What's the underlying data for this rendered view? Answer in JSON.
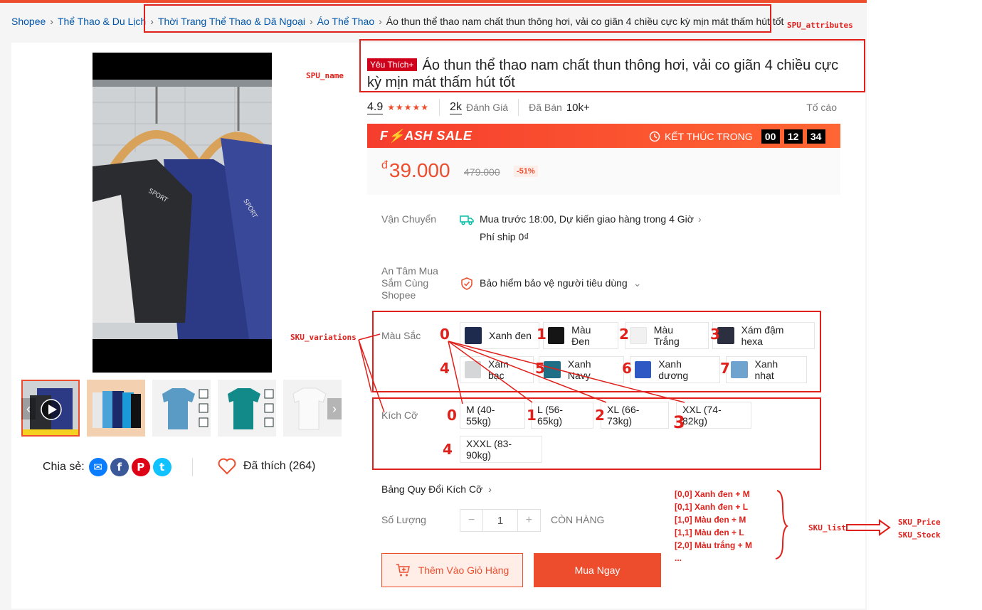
{
  "breadcrumb": [
    "Shopee",
    "Thể Thao & Du Lịch",
    "Thời Trang Thể Thao & Dã Ngoại",
    "Áo Thể Thao",
    "Áo thun thể thao nam chất thun thông hơi, vải co giãn 4 chiều cực kỳ mịn mát thấm hút tốt"
  ],
  "product": {
    "badge": "Yêu Thích+",
    "title": "Áo thun thể thao nam chất thun thông hơi, vải co giãn 4 chiều cực kỳ mịn mát thấm hút tốt",
    "rating": "4.9",
    "stars": "★★★★★",
    "reviews_count": "2k",
    "reviews_label": "Đánh Giá",
    "sold_label": "Đã Bán",
    "sold_count": "10k+",
    "report": "Tố cáo"
  },
  "flash_sale": {
    "title": "F⚡ASH SALE",
    "ends_label": "KẾT THÚC TRONG",
    "hours": "00",
    "minutes": "12",
    "seconds": "34",
    "price_currency": "đ",
    "price": "39.000",
    "old_price": "479.000",
    "discount": "-51%"
  },
  "shipping": {
    "label": "Vận Chuyển",
    "line1": "Mua trước 18:00, Dự kiến giao hàng trong 4 Giờ",
    "line2": "Phí ship 0₫"
  },
  "guarantee": {
    "label": "An Tâm Mua Sắm Cùng Shopee",
    "text": "Bảo hiểm bảo vệ người tiêu dùng"
  },
  "color": {
    "label": "Màu Sắc",
    "options": [
      "Xanh đen",
      "Màu Đen",
      "Màu Trắng",
      "Xám đậm hexa",
      "Xám bạc",
      "Xanh Navy",
      "Xanh dương",
      "Xanh nhạt"
    ]
  },
  "size": {
    "label": "Kích Cỡ",
    "options": [
      "M (40-55kg)",
      "L (56-65kg)",
      "XL (66-73kg)",
      "XXL (74-82kg)",
      "XXXL (83-90kg)"
    ]
  },
  "size_guide": "Bảng Quy Đổi Kích Cỡ",
  "quantity": {
    "label": "Số Lượng",
    "minus": "−",
    "value": "1",
    "plus": "+",
    "stock": "CÒN HÀNG"
  },
  "actions": {
    "add_to_cart": "Thêm Vào Giỏ Hàng",
    "buy_now": "Mua Ngay"
  },
  "share": {
    "label": "Chia sẻ:",
    "liked": "Đã thích (264)"
  },
  "annotations": {
    "spu_attributes": "SPU_attributes",
    "spu_name": "SPU_name",
    "sku_variations": "SKU_variations",
    "sku_list": "SKU_list",
    "sku_price": "SKU_Price",
    "sku_stock": "SKU_Stock",
    "color_indices": [
      "0",
      "1",
      "2",
      "3",
      "4",
      "5",
      "6",
      "7"
    ],
    "size_indices": [
      "0",
      "1",
      "2",
      "3",
      "4"
    ],
    "sku_examples": [
      "[0,0] Xanh đen + M",
      "[0,1] Xanh đen + L",
      "[1,0] Màu đen + M",
      "[1,1] Màu đen + L",
      "[2,0] Màu trắng  + M",
      "..."
    ]
  },
  "colors": {
    "brand": "#ee4d2d",
    "annotation": "#e0201b",
    "link": "#0055aa"
  }
}
